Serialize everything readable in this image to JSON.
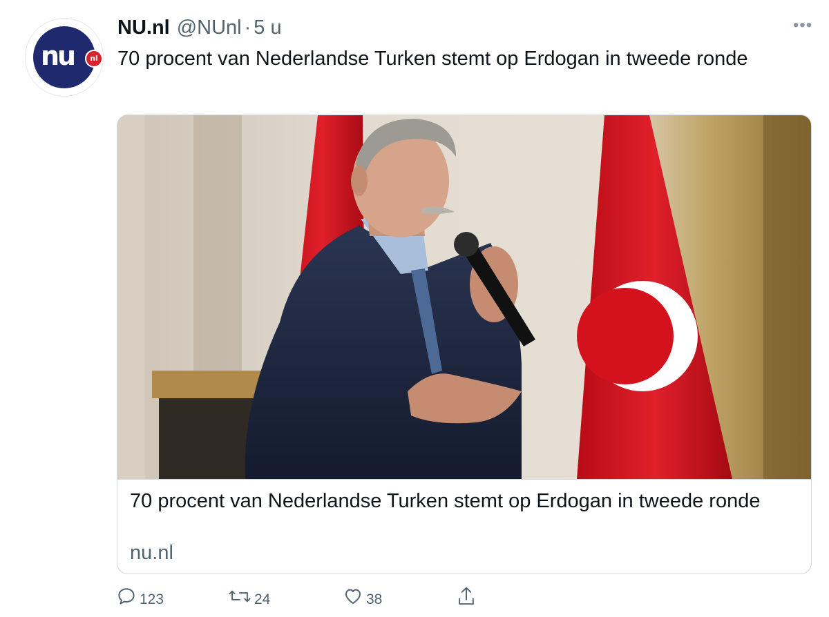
{
  "tweet": {
    "author": {
      "name": "NU.nl",
      "handle": "@NUnl",
      "separator": "·",
      "time": "5 u",
      "avatar_logo_text": "nu",
      "avatar_badge_text": "nl"
    },
    "more_icon": "more-dots-icon",
    "text": "70 procent van Nederlandse Turken stemt op Erdogan in tweede ronde",
    "card": {
      "title": "70 procent van Nederlandse Turken stemt op Erdogan in tweede ronde",
      "domain": "nu.nl"
    },
    "actions": {
      "reply": {
        "icon": "reply-icon",
        "count": "123"
      },
      "retweet": {
        "icon": "retweet-icon",
        "count": "24"
      },
      "like": {
        "icon": "heart-icon",
        "count": "38"
      },
      "share": {
        "icon": "share-icon"
      }
    }
  },
  "colors": {
    "text_primary": "#0f1419",
    "text_secondary": "#536471",
    "card_border": "#cfd9de",
    "nu_blue": "#1f2a6e",
    "nu_red": "#d8212a",
    "flag_red": "#d4121e"
  }
}
